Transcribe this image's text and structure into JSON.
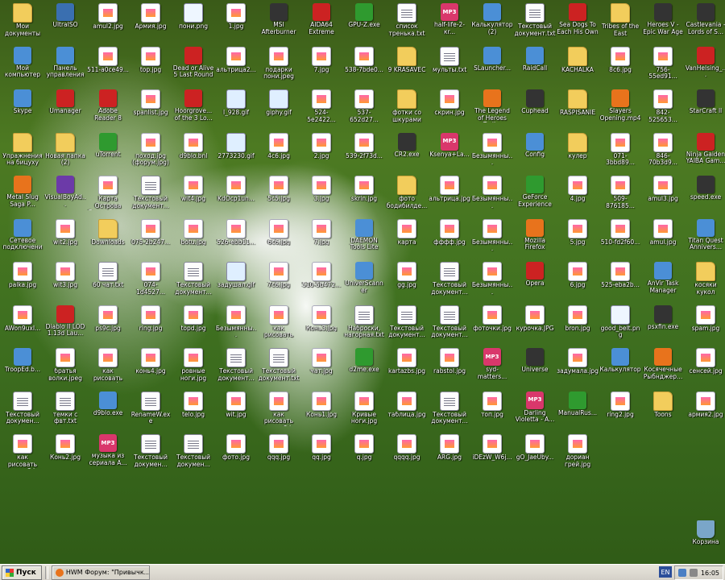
{
  "desktop": {
    "icons": [
      [
        "Мои документы",
        "folder"
      ],
      [
        "UltraISO",
        "exe"
      ],
      [
        "amul2.jpg",
        "jpg"
      ],
      [
        "Армия.jpg",
        "jpg"
      ],
      [
        "пони.png",
        "png"
      ],
      [
        "1.jpg",
        "jpg"
      ],
      [
        "MSI Afterburner",
        "dark"
      ],
      [
        "AIDA64 Extreme",
        "red"
      ],
      [
        "GPU-Z.exe",
        "green"
      ],
      [
        "список тренька.txt",
        "txt"
      ],
      [
        "half-life-2-кr...",
        "mp3"
      ],
      [
        "Калькулятор (2)",
        "sys"
      ],
      [
        "Текстовый документ.txt",
        "txt"
      ],
      [
        "Sea Dogs To Each His Own",
        "red"
      ],
      [
        "Tribes of the East",
        "folder"
      ],
      [
        "Heroes V - Epic War Age",
        "dark"
      ],
      [
        "Castlevania - Lords of S...",
        "dark"
      ],
      [
        "Мой компьютер",
        "sys"
      ],
      [
        "Панель управления",
        "sys"
      ],
      [
        "511-a0ce49...",
        "jpg"
      ],
      [
        "top.jpg",
        "jpg"
      ],
      [
        "Dead or Alive 5 Last Round",
        "red"
      ],
      [
        "альтрица2...",
        "jpg"
      ],
      [
        "подарки пони.jpeg",
        "jpg"
      ],
      [
        "7.jpg",
        "jpg"
      ],
      [
        "538-7bde0...",
        "jpg"
      ],
      [
        "9 KRASAVEC",
        "folder"
      ],
      [
        "мульты.txt",
        "txt"
      ],
      [
        "SLauncher...",
        "sys"
      ],
      [
        "RaidCall",
        "sys"
      ],
      [
        "KACHALKA",
        "folder"
      ],
      [
        "8c6.jpg",
        "jpg"
      ],
      [
        "756-55ed91...",
        "jpg"
      ],
      [
        "VanHelsing_...",
        "red"
      ],
      [
        "Skype",
        "sys"
      ],
      [
        "Umanager",
        "red"
      ],
      [
        "Adobe Reader 8",
        "red"
      ],
      [
        "spanlist.jpg",
        "jpg"
      ],
      [
        "Hoorgrove... of the 3 Lo...",
        "red"
      ],
      [
        "l_928.gif",
        "gif"
      ],
      [
        "giphy.gif",
        "gif"
      ],
      [
        "524-5e2422...",
        "jpg"
      ],
      [
        "537-652d27...",
        "jpg"
      ],
      [
        "фотки со шкурами",
        "folder"
      ],
      [
        "скрин.jpg",
        "jpg"
      ],
      [
        "The Legend of Heroes Trail...",
        "orange"
      ],
      [
        "Cuphead",
        "dark"
      ],
      [
        "RASPISANIE",
        "folder"
      ],
      [
        "Slayers Opening.mp4",
        "orange"
      ],
      [
        "842-525653...",
        "jpg"
      ],
      [
        "StarCraft II",
        "dark"
      ],
      [
        "Упражнения на бицуху",
        "folder"
      ],
      [
        "Новая папка (2)",
        "folder"
      ],
      [
        "uTorrent",
        "green"
      ],
      [
        "поход.jpg (форум.jpg)",
        "jpg"
      ],
      [
        "d9blo.bnl",
        "jpg"
      ],
      [
        "2773230.gif",
        "gif"
      ],
      [
        "4c6.jpg",
        "jpg"
      ],
      [
        "2.jpg",
        "jpg"
      ],
      [
        "539-2f73d...",
        "jpg"
      ],
      [
        "CR2.exe",
        "dark"
      ],
      [
        "Ksenya+La...",
        "mp3"
      ],
      [
        "Безымянны...",
        "jpg"
      ],
      [
        "Config",
        "sys"
      ],
      [
        "кулер",
        "folder"
      ],
      [
        "071-3bbd89...",
        "jpg"
      ],
      [
        "846-70b3d9...",
        "jpg"
      ],
      [
        "Ninja Gaiden YAIBA Gam...",
        "red"
      ],
      [
        "Metal Slug Saga P...",
        "orange"
      ],
      [
        "VisualBoyAd...",
        "purple"
      ],
      [
        "Карта Острова Справедли...",
        "jpg"
      ],
      [
        "Текстовый документ...",
        "txt"
      ],
      [
        "wit4.jpg",
        "jpg"
      ],
      [
        "KdOcp1un...",
        "jpg"
      ],
      [
        "5c5.jpg",
        "jpg"
      ],
      [
        "3.jpg",
        "jpg"
      ],
      [
        "skrin.jpg",
        "jpg"
      ],
      [
        "фото бодибилде...",
        "folder"
      ],
      [
        "альтрица.jpg",
        "jpg"
      ],
      [
        "Безымянны...",
        "jpg"
      ],
      [
        "GeForce Experience",
        "green"
      ],
      [
        "4.jpg",
        "jpg"
      ],
      [
        "509-876185...",
        "jpg"
      ],
      [
        "amul3.jpg",
        "jpg"
      ],
      [
        "speed.exe",
        "dark"
      ],
      [
        "Сетевое подключения",
        "sys"
      ],
      [
        "wit2.jpg",
        "jpg"
      ],
      [
        "Downloads",
        "folder"
      ],
      [
        "075-2b247...",
        "jpg"
      ],
      [
        "botu.jpg",
        "jpg"
      ],
      [
        "526-ebb11...",
        "jpg"
      ],
      [
        "6c6.jpg",
        "jpg"
      ],
      [
        "7.jpg",
        "jpg"
      ],
      [
        "DAEMON Tools Lite",
        "sys"
      ],
      [
        "картa",
        "jpg"
      ],
      [
        "фффф.jpg",
        "jpg"
      ],
      [
        "Безымянны...",
        "jpg"
      ],
      [
        "Mozilla Firefox",
        "orange"
      ],
      [
        "5.jpg",
        "jpg"
      ],
      [
        "510-fd2f60...",
        "jpg"
      ],
      [
        "amul.jpg",
        "jpg"
      ],
      [
        "Titan Quest Annivers...",
        "sys"
      ],
      [
        "palka.jpg",
        "jpg"
      ],
      [
        "wit3.jpg",
        "jpg"
      ],
      [
        "60 чат.txt",
        "txt"
      ],
      [
        "074-1d4527...",
        "jpg"
      ],
      [
        "Текстовый документ...",
        "txt"
      ],
      [
        "задушал.gif",
        "gif"
      ],
      [
        "7с6.jpg",
        "jpg"
      ],
      [
        "510-5b472...",
        "jpg"
      ],
      [
        "UniverScanner",
        "sys"
      ],
      [
        "gg.jpg",
        "jpg"
      ],
      [
        "Текстовый документ...",
        "txt"
      ],
      [
        "Безымянны...",
        "jpg"
      ],
      [
        "Opera",
        "red"
      ],
      [
        "6.jpg",
        "jpg"
      ],
      [
        "525-eba2b...",
        "jpg"
      ],
      [
        "AnVir Task Manager",
        "sys"
      ],
      [
        "косяки кукол",
        "folder"
      ],
      [
        "AWon9uxI...",
        "jpg"
      ],
      [
        "Diablo II LOD 1.13d Lau...",
        "red"
      ],
      [
        "ps9c.jpg",
        "jpg"
      ],
      [
        "ring.jpg",
        "jpg"
      ],
      [
        "topd.jpg",
        "jpg"
      ],
      [
        "Безымянны...",
        "jpg"
      ],
      [
        "как рисовать лошадь.jpg",
        "jpg"
      ],
      [
        "Конь3.jpg",
        "jpg"
      ],
      [
        "Наброски, нагорная.txt",
        "txt"
      ],
      [
        "Текстовый документ...",
        "txt"
      ],
      [
        "Текстовый документ...",
        "txt"
      ],
      [
        "фоточки.jpg",
        "jpg"
      ],
      [
        "курочка.JPG",
        "jpg"
      ],
      [
        "bron.jpg",
        "jpg"
      ],
      [
        "good_belt.png",
        "png"
      ],
      [
        "psxfin.exe",
        "dark"
      ],
      [
        "spam.jpg",
        "jpg"
      ],
      [
        "TroopEd.b...",
        "sys"
      ],
      [
        "братья волки.jpeg",
        "jpg"
      ],
      [
        "как рисовать лошадь.jpg",
        "jpg"
      ],
      [
        "конь4.jpg",
        "jpg"
      ],
      [
        "ровные ноги.jpg",
        "jpg"
      ],
      [
        "Текстовый документ...",
        "txt"
      ],
      [
        "Текстовый документ.txt",
        "txt"
      ],
      [
        "чат.jpg",
        "jpg"
      ],
      [
        "d2me.exe",
        "green"
      ],
      [
        "kartazbs.jpg",
        "jpg"
      ],
      [
        "rabstol.jpg",
        "jpg"
      ],
      [
        "syd-matters...",
        "mp3"
      ],
      [
        "Universe",
        "dark"
      ],
      [
        "задумала.jpg",
        "jpg"
      ],
      [
        "Калькулятор",
        "sys"
      ],
      [
        "Косячечные Рыбнджер...",
        "orange"
      ],
      [
        "сенсей.jpg",
        "jpg"
      ],
      [
        "Текстовый докумен...",
        "txt"
      ],
      [
        "темки с фвт.txt",
        "txt"
      ],
      [
        "d9blo.exe",
        "sys"
      ],
      [
        "RenameW.exe",
        "txt"
      ],
      [
        "telo.jpg",
        "jpg"
      ],
      [
        "wit.jpg",
        "jpg"
      ],
      [
        "как рисовать лошадь2.jpg",
        "jpg"
      ],
      [
        "Конь1.jpg",
        "jpg"
      ],
      [
        "Кривые ноги.jpg",
        "jpg"
      ],
      [
        "таблица.jpg",
        "jpg"
      ],
      [
        "Текстовый документ...",
        "txt"
      ],
      [
        "топ.jpg",
        "jpg"
      ],
      [
        "Darling Violetta - A...",
        "mp3"
      ],
      [
        "ManualRus...",
        "green"
      ],
      [
        "ring2.jpg",
        "jpg"
      ],
      [
        "Toons",
        "folder"
      ],
      [
        "армия2.jpg",
        "jpg"
      ],
      [
        "как рисовать лошадь3.jpg",
        "jpg"
      ],
      [
        "Конь2.jpg",
        "jpg"
      ],
      [
        "музыка из сериала А...",
        "mp3"
      ],
      [
        "Текстовый докумен...",
        "txt"
      ],
      [
        "Текстовый докумен...",
        "txt"
      ],
      [
        "фото.jpg",
        "jpg"
      ],
      [
        "qqq.jpg",
        "jpg"
      ],
      [
        "qq.jpg",
        "jpg"
      ],
      [
        "q.jpg",
        "jpg"
      ],
      [
        "qqqq.jpg",
        "jpg"
      ],
      [
        "ARG.jpg",
        "jpg"
      ],
      [
        "iDEzW_W6j...",
        "jpg"
      ],
      [
        "gO_JaeUby...",
        "jpg"
      ],
      [
        "дориан грей.jpg",
        "jpg"
      ],
      [
        "Корзина",
        "trash"
      ]
    ]
  },
  "taskbar": {
    "start_label": "Пуск",
    "task_label": "HWM Форум: \"Привычк...",
    "lang": "EN",
    "clock": "16:05"
  }
}
